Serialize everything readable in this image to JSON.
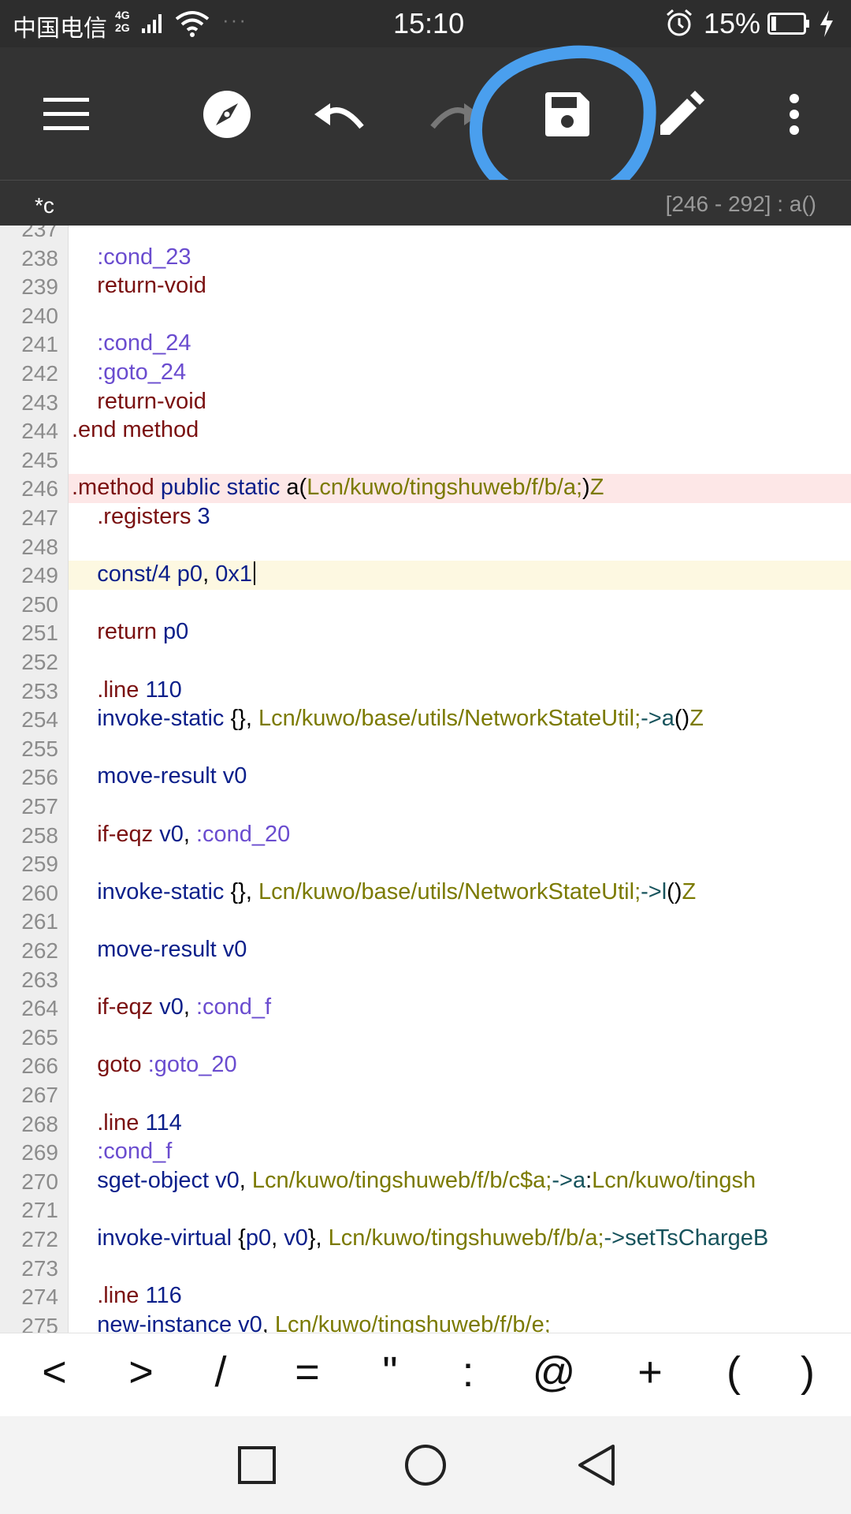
{
  "status_bar": {
    "carrier": "中国电信",
    "network_top": "4G",
    "network_bottom": "2G",
    "time": "15:10",
    "battery_percent": "15%",
    "battery_level": 0.15
  },
  "toolbar": {
    "icons": [
      "menu-icon",
      "compass-icon",
      "undo-icon",
      "redo-icon",
      "save-icon",
      "edit-icon",
      "more-icon"
    ],
    "annotation_color": "#4a9fee"
  },
  "tab": {
    "file_name": "*c",
    "position": "[246 - 292] : a()"
  },
  "editor": {
    "lines": [
      {
        "n": "237",
        "tokens": []
      },
      {
        "n": "238",
        "tokens": [
          [
            "l",
            "    :cond_23"
          ]
        ]
      },
      {
        "n": "239",
        "tokens": [
          [
            "k",
            "    return-void"
          ]
        ]
      },
      {
        "n": "240",
        "tokens": []
      },
      {
        "n": "241",
        "tokens": [
          [
            "l",
            "    :cond_24"
          ]
        ]
      },
      {
        "n": "242",
        "tokens": [
          [
            "l",
            "    :goto_24"
          ]
        ]
      },
      {
        "n": "243",
        "tokens": [
          [
            "k",
            "    return-void"
          ]
        ]
      },
      {
        "n": "244",
        "tokens": [
          [
            "k",
            ".end method"
          ]
        ]
      },
      {
        "n": "245",
        "tokens": []
      },
      {
        "n": "246",
        "hl": "red",
        "tokens": [
          [
            "k",
            ".method "
          ],
          [
            "r",
            "public static "
          ],
          [
            "p",
            "a("
          ],
          [
            "t",
            "Lcn/kuwo/tingshuweb/f/b/a;"
          ],
          [
            "p",
            ")"
          ],
          [
            "t",
            "Z"
          ]
        ]
      },
      {
        "n": "247",
        "tokens": [
          [
            "k",
            "    .registers "
          ],
          [
            "r",
            "3"
          ]
        ]
      },
      {
        "n": "248",
        "tokens": []
      },
      {
        "n": "249",
        "hl": "yellow",
        "caret": true,
        "tokens": [
          [
            "r",
            "    const/4 "
          ],
          [
            "r",
            "p0"
          ],
          [
            "p",
            ", "
          ],
          [
            "r",
            "0x1"
          ]
        ]
      },
      {
        "n": "250",
        "tokens": []
      },
      {
        "n": "251",
        "tokens": [
          [
            "k",
            "    return "
          ],
          [
            "r",
            "p0"
          ]
        ]
      },
      {
        "n": "252",
        "tokens": []
      },
      {
        "n": "253",
        "tokens": [
          [
            "k",
            "    .line "
          ],
          [
            "r",
            "110"
          ]
        ]
      },
      {
        "n": "254",
        "tokens": [
          [
            "r",
            "    invoke-static "
          ],
          [
            "p",
            "{}, "
          ],
          [
            "t",
            "Lcn/kuwo/base/utils/NetworkStateUtil;"
          ],
          [
            "m",
            "->a"
          ],
          [
            "p",
            "()"
          ],
          [
            "t",
            "Z"
          ]
        ]
      },
      {
        "n": "255",
        "tokens": []
      },
      {
        "n": "256",
        "tokens": [
          [
            "r",
            "    move-result v0"
          ]
        ]
      },
      {
        "n": "257",
        "tokens": []
      },
      {
        "n": "258",
        "tokens": [
          [
            "k",
            "    if-eqz "
          ],
          [
            "r",
            "v0"
          ],
          [
            "p",
            ", "
          ],
          [
            "l",
            ":cond_20"
          ]
        ]
      },
      {
        "n": "259",
        "tokens": []
      },
      {
        "n": "260",
        "tokens": [
          [
            "r",
            "    invoke-static "
          ],
          [
            "p",
            "{}, "
          ],
          [
            "t",
            "Lcn/kuwo/base/utils/NetworkStateUtil;"
          ],
          [
            "m",
            "->l"
          ],
          [
            "p",
            "()"
          ],
          [
            "t",
            "Z"
          ]
        ]
      },
      {
        "n": "261",
        "tokens": []
      },
      {
        "n": "262",
        "tokens": [
          [
            "r",
            "    move-result v0"
          ]
        ]
      },
      {
        "n": "263",
        "tokens": []
      },
      {
        "n": "264",
        "tokens": [
          [
            "k",
            "    if-eqz "
          ],
          [
            "r",
            "v0"
          ],
          [
            "p",
            ", "
          ],
          [
            "l",
            ":cond_f"
          ]
        ]
      },
      {
        "n": "265",
        "tokens": []
      },
      {
        "n": "266",
        "tokens": [
          [
            "k",
            "    goto "
          ],
          [
            "l",
            ":goto_20"
          ]
        ]
      },
      {
        "n": "267",
        "tokens": []
      },
      {
        "n": "268",
        "tokens": [
          [
            "k",
            "    .line "
          ],
          [
            "r",
            "114"
          ]
        ]
      },
      {
        "n": "269",
        "tokens": [
          [
            "l",
            "    :cond_f"
          ]
        ]
      },
      {
        "n": "270",
        "tokens": [
          [
            "r",
            "    sget-object v0"
          ],
          [
            "p",
            ", "
          ],
          [
            "t",
            "Lcn/kuwo/tingshuweb/f/b/c$a;"
          ],
          [
            "m",
            "->a"
          ],
          [
            "p",
            ":"
          ],
          [
            "t",
            "Lcn/kuwo/tingsh"
          ]
        ]
      },
      {
        "n": "271",
        "tokens": []
      },
      {
        "n": "272",
        "tokens": [
          [
            "r",
            "    invoke-virtual "
          ],
          [
            "p",
            "{"
          ],
          [
            "r",
            "p0"
          ],
          [
            "p",
            ", "
          ],
          [
            "r",
            "v0"
          ],
          [
            "p",
            "}, "
          ],
          [
            "t",
            "Lcn/kuwo/tingshuweb/f/b/a;"
          ],
          [
            "m",
            "->setTsChargeB"
          ]
        ]
      },
      {
        "n": "273",
        "tokens": []
      },
      {
        "n": "274",
        "tokens": [
          [
            "k",
            "    .line "
          ],
          [
            "r",
            "116"
          ]
        ]
      },
      {
        "n": "275",
        "tokens": [
          [
            "r",
            "    new-instance v0"
          ],
          [
            "p",
            ", "
          ],
          [
            "t",
            "Lcn/kuwo/tingshuweb/f/b/e;"
          ]
        ]
      }
    ]
  },
  "symbol_bar": {
    "keys": [
      "<",
      ">",
      "/",
      "=",
      "\"",
      ":",
      "@",
      "+",
      "(",
      ")"
    ]
  },
  "nav_bar": {
    "icons": [
      "recents-icon",
      "home-icon",
      "back-icon"
    ]
  }
}
